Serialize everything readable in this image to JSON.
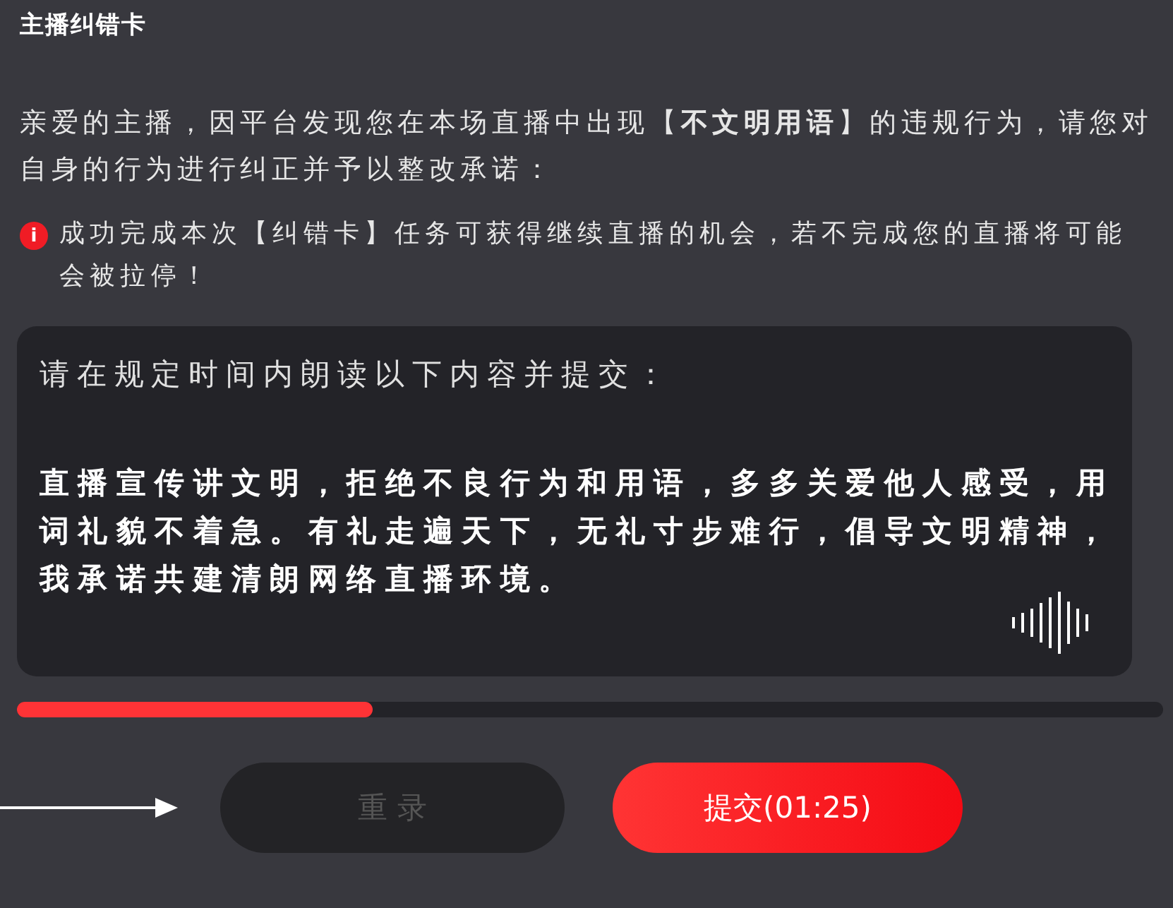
{
  "title": "主播纠错卡",
  "message": "亲爱的主播，因平台发现您在本场直播中出现【**不文明用语**】的违规行为，请您对自身的行为进行纠正并予以整改承诺：",
  "notice": {
    "icon": "i",
    "text": "成功完成本次【纠错卡】任务可获得继续直播的机会，若不完成您的直播将可能会被拉停！"
  },
  "card": {
    "prompt": "请在规定时间内朗读以下内容并提交：",
    "content": "直播宣传讲文明，拒绝不良行为和用语，多多关爱他人感受，用词礼貌不着急。有礼走遍天下，无礼寸步难行，倡导文明精神，我承诺共建清朗网络直播环境。"
  },
  "progress": {
    "level": 0.31
  },
  "buttons": [
    {
      "label": "重 录",
      "kind": "secondary",
      "disabled": true
    },
    {
      "label": "提交(01:25)",
      "kind": "primary",
      "disabled": false
    }
  ]
}
